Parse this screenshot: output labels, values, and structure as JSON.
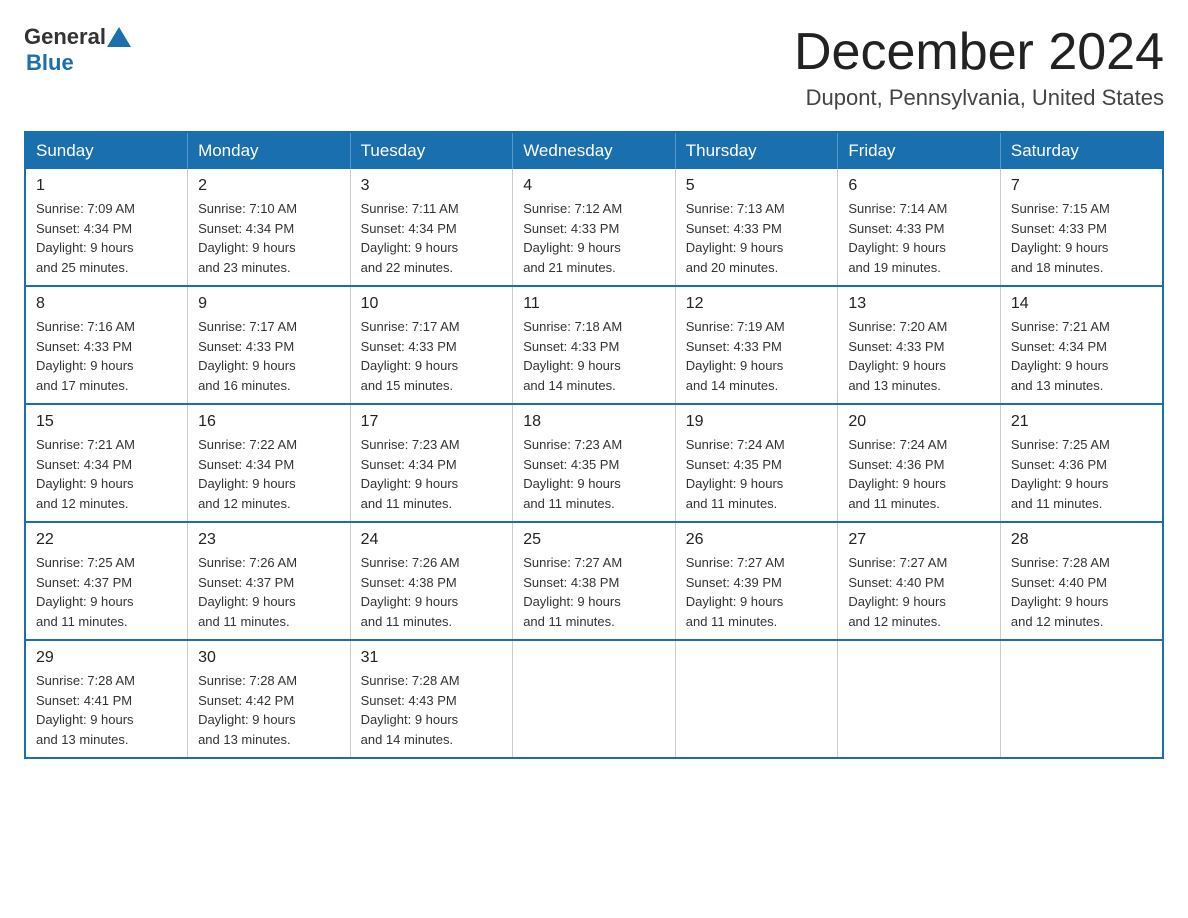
{
  "header": {
    "logo_general": "General",
    "logo_blue": "Blue",
    "month_title": "December 2024",
    "location": "Dupont, Pennsylvania, United States"
  },
  "days_of_week": [
    "Sunday",
    "Monday",
    "Tuesday",
    "Wednesday",
    "Thursday",
    "Friday",
    "Saturday"
  ],
  "weeks": [
    [
      {
        "day": "1",
        "sunrise": "7:09 AM",
        "sunset": "4:34 PM",
        "daylight": "9 hours and 25 minutes."
      },
      {
        "day": "2",
        "sunrise": "7:10 AM",
        "sunset": "4:34 PM",
        "daylight": "9 hours and 23 minutes."
      },
      {
        "day": "3",
        "sunrise": "7:11 AM",
        "sunset": "4:34 PM",
        "daylight": "9 hours and 22 minutes."
      },
      {
        "day": "4",
        "sunrise": "7:12 AM",
        "sunset": "4:33 PM",
        "daylight": "9 hours and 21 minutes."
      },
      {
        "day": "5",
        "sunrise": "7:13 AM",
        "sunset": "4:33 PM",
        "daylight": "9 hours and 20 minutes."
      },
      {
        "day": "6",
        "sunrise": "7:14 AM",
        "sunset": "4:33 PM",
        "daylight": "9 hours and 19 minutes."
      },
      {
        "day": "7",
        "sunrise": "7:15 AM",
        "sunset": "4:33 PM",
        "daylight": "9 hours and 18 minutes."
      }
    ],
    [
      {
        "day": "8",
        "sunrise": "7:16 AM",
        "sunset": "4:33 PM",
        "daylight": "9 hours and 17 minutes."
      },
      {
        "day": "9",
        "sunrise": "7:17 AM",
        "sunset": "4:33 PM",
        "daylight": "9 hours and 16 minutes."
      },
      {
        "day": "10",
        "sunrise": "7:17 AM",
        "sunset": "4:33 PM",
        "daylight": "9 hours and 15 minutes."
      },
      {
        "day": "11",
        "sunrise": "7:18 AM",
        "sunset": "4:33 PM",
        "daylight": "9 hours and 14 minutes."
      },
      {
        "day": "12",
        "sunrise": "7:19 AM",
        "sunset": "4:33 PM",
        "daylight": "9 hours and 14 minutes."
      },
      {
        "day": "13",
        "sunrise": "7:20 AM",
        "sunset": "4:33 PM",
        "daylight": "9 hours and 13 minutes."
      },
      {
        "day": "14",
        "sunrise": "7:21 AM",
        "sunset": "4:34 PM",
        "daylight": "9 hours and 13 minutes."
      }
    ],
    [
      {
        "day": "15",
        "sunrise": "7:21 AM",
        "sunset": "4:34 PM",
        "daylight": "9 hours and 12 minutes."
      },
      {
        "day": "16",
        "sunrise": "7:22 AM",
        "sunset": "4:34 PM",
        "daylight": "9 hours and 12 minutes."
      },
      {
        "day": "17",
        "sunrise": "7:23 AM",
        "sunset": "4:34 PM",
        "daylight": "9 hours and 11 minutes."
      },
      {
        "day": "18",
        "sunrise": "7:23 AM",
        "sunset": "4:35 PM",
        "daylight": "9 hours and 11 minutes."
      },
      {
        "day": "19",
        "sunrise": "7:24 AM",
        "sunset": "4:35 PM",
        "daylight": "9 hours and 11 minutes."
      },
      {
        "day": "20",
        "sunrise": "7:24 AM",
        "sunset": "4:36 PM",
        "daylight": "9 hours and 11 minutes."
      },
      {
        "day": "21",
        "sunrise": "7:25 AM",
        "sunset": "4:36 PM",
        "daylight": "9 hours and 11 minutes."
      }
    ],
    [
      {
        "day": "22",
        "sunrise": "7:25 AM",
        "sunset": "4:37 PM",
        "daylight": "9 hours and 11 minutes."
      },
      {
        "day": "23",
        "sunrise": "7:26 AM",
        "sunset": "4:37 PM",
        "daylight": "9 hours and 11 minutes."
      },
      {
        "day": "24",
        "sunrise": "7:26 AM",
        "sunset": "4:38 PM",
        "daylight": "9 hours and 11 minutes."
      },
      {
        "day": "25",
        "sunrise": "7:27 AM",
        "sunset": "4:38 PM",
        "daylight": "9 hours and 11 minutes."
      },
      {
        "day": "26",
        "sunrise": "7:27 AM",
        "sunset": "4:39 PM",
        "daylight": "9 hours and 11 minutes."
      },
      {
        "day": "27",
        "sunrise": "7:27 AM",
        "sunset": "4:40 PM",
        "daylight": "9 hours and 12 minutes."
      },
      {
        "day": "28",
        "sunrise": "7:28 AM",
        "sunset": "4:40 PM",
        "daylight": "9 hours and 12 minutes."
      }
    ],
    [
      {
        "day": "29",
        "sunrise": "7:28 AM",
        "sunset": "4:41 PM",
        "daylight": "9 hours and 13 minutes."
      },
      {
        "day": "30",
        "sunrise": "7:28 AM",
        "sunset": "4:42 PM",
        "daylight": "9 hours and 13 minutes."
      },
      {
        "day": "31",
        "sunrise": "7:28 AM",
        "sunset": "4:43 PM",
        "daylight": "9 hours and 14 minutes."
      },
      null,
      null,
      null,
      null
    ]
  ],
  "labels": {
    "sunrise": "Sunrise:",
    "sunset": "Sunset:",
    "daylight": "Daylight:"
  }
}
